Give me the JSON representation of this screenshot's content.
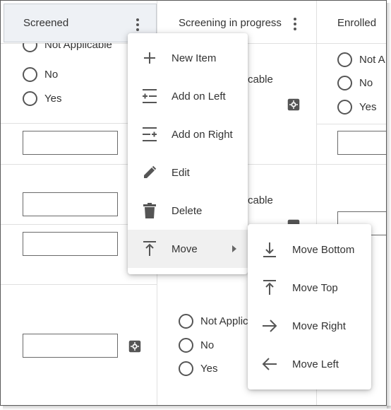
{
  "columns": [
    {
      "title": "Screened"
    },
    {
      "title": "Screening in progress"
    },
    {
      "title": "Enrolled"
    }
  ],
  "radio_options": {
    "not_applicable": "Not Applicable",
    "no": "No",
    "yes": "Yes",
    "col2_partial_top": "cable",
    "col2_partial_mid": "cable",
    "col2_partial_bottom": "Not Applic",
    "col3_partial": "Not A"
  },
  "context_menu": {
    "items": [
      {
        "label": "New Item",
        "icon": "plus-icon"
      },
      {
        "label": "Add on Left",
        "icon": "add-left-icon"
      },
      {
        "label": "Add on Right",
        "icon": "add-right-icon"
      },
      {
        "label": "Edit",
        "icon": "pencil-icon"
      },
      {
        "label": "Delete",
        "icon": "trash-icon"
      },
      {
        "label": "Move",
        "icon": "move-icon"
      }
    ]
  },
  "move_submenu": {
    "items": [
      {
        "label": "Move Bottom",
        "icon": "move-bottom-icon"
      },
      {
        "label": "Move Top",
        "icon": "move-top-icon"
      },
      {
        "label": "Move Right",
        "icon": "arrow-right-icon"
      },
      {
        "label": "Move Left",
        "icon": "arrow-left-icon"
      }
    ]
  },
  "colors": {
    "icon": "#555555",
    "selected_header": "#eef1f5",
    "menu_active": "#f0f0f0",
    "grid": "#e0e0e0"
  }
}
